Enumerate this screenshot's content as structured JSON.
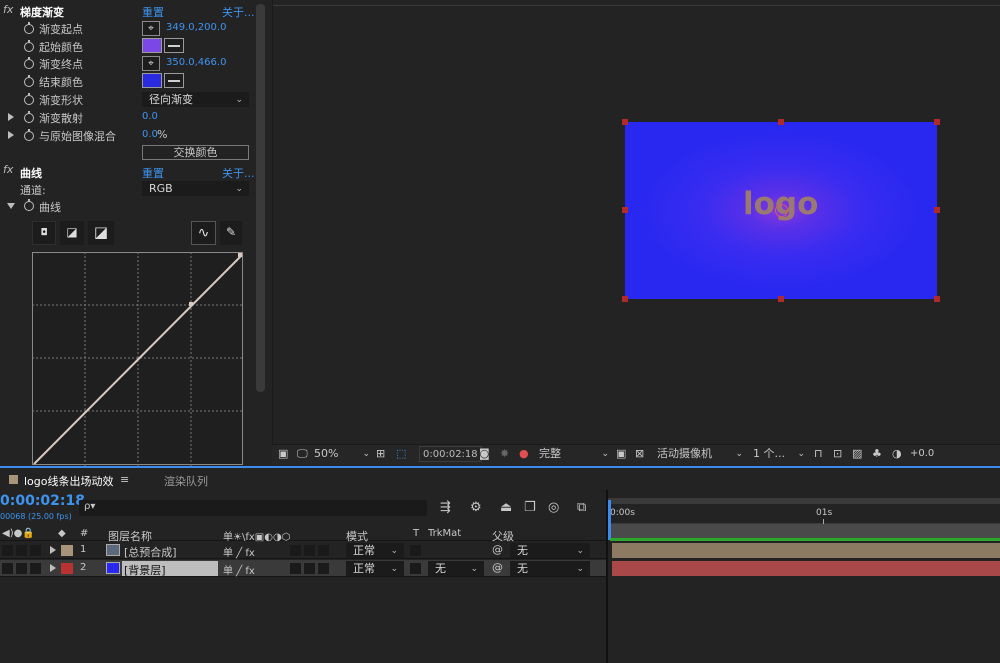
{
  "effects": {
    "gradient": {
      "fx": "fx",
      "title": "梯度渐变",
      "reset": "重置",
      "about": "关于...",
      "start_point_label": "渐变起点",
      "start_point_value": "349.0,200.0",
      "start_color_label": "起始颜色",
      "start_color": "#7b47e6",
      "end_point_label": "渐变终点",
      "end_point_value": "350.0,466.0",
      "end_color_label": "结束颜色",
      "end_color": "#2a2ae0",
      "shape_label": "渐变形状",
      "shape_value": "径向渐变",
      "scatter_label": "渐变散射",
      "scatter_value": "0.0",
      "blend_label": "与原始图像混合",
      "blend_value": "0.0",
      "blend_unit": "%",
      "swap_button": "交换颜色"
    },
    "curves": {
      "fx": "fx",
      "title": "曲线",
      "reset": "重置",
      "about": "关于...",
      "channel_label": "通道:",
      "channel_value": "RGB",
      "curve_label": "曲线"
    }
  },
  "viewer": {
    "logo_text": "logo",
    "comp_color": "#2828f0",
    "zoom": "50%",
    "timecode": "0:00:02:18",
    "resolution": "完整",
    "camera": "活动摄像机",
    "views": "1 个...",
    "exposure": "+0.0"
  },
  "timeline": {
    "tab_label": "logo线条出场动效",
    "tab_menu": "≡",
    "render_tab": "渲染队列",
    "timecode": "0:00:02:18",
    "fps_info": "00068 (25.00 fps)",
    "search_icon": "ρ▾",
    "columns": {
      "hash": "#",
      "layer_name": "图层名称",
      "switches": "单☀\\fx▣◐◑⬡",
      "mode": "模式",
      "t": "T",
      "trkmat": "TrkMat",
      "parent": "父级"
    },
    "ruler": {
      "start": "0:00s",
      "mark": "01s"
    },
    "layers": [
      {
        "index": "1",
        "name": "[总预合成]",
        "label_color": "#a89478",
        "mode": "正常",
        "trkmat": "",
        "parent": "无",
        "bar_color": "#8c7a62"
      },
      {
        "index": "2",
        "name": "[背景层]",
        "label_color": "#b83232",
        "mode": "正常",
        "trkmat": "无",
        "parent": "无",
        "bar_color": "#a84848"
      }
    ]
  }
}
